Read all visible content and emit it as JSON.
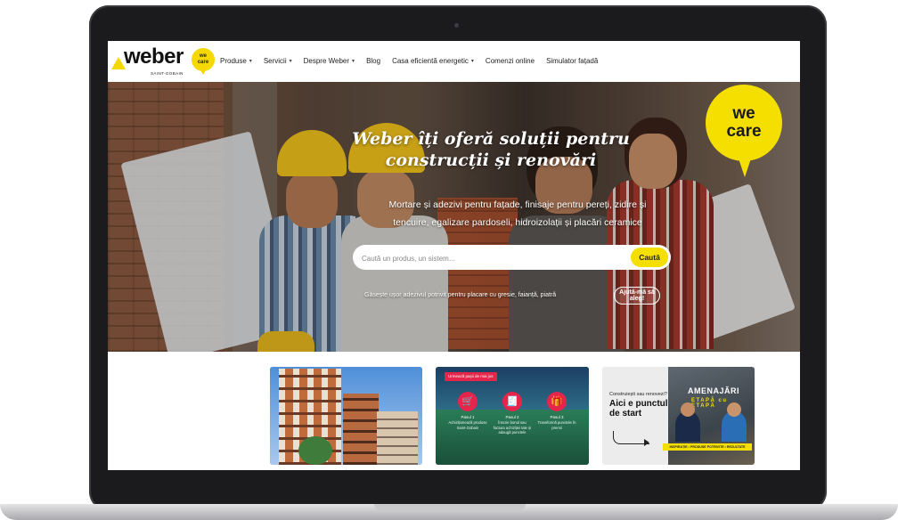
{
  "nav": {
    "logo_word": "weber",
    "logo_sub": "SAINT-GOBAIN",
    "logo_badge_top": "we",
    "logo_badge_bottom": "care",
    "menu": [
      {
        "label": "Produse",
        "dropdown": true
      },
      {
        "label": "Servicii",
        "dropdown": true
      },
      {
        "label": "Despre Weber",
        "dropdown": true
      },
      {
        "label": "Blog",
        "dropdown": false
      },
      {
        "label": "Casa eficientă energetic",
        "dropdown": true
      },
      {
        "label": "Comenzi online",
        "dropdown": false
      },
      {
        "label": "Simulator fațadă",
        "dropdown": false
      }
    ],
    "caret_glyph": "▾"
  },
  "hero": {
    "title_line1": "Weber îți oferă soluții pentru",
    "title_line2": "construcții și renovări",
    "subtitle_line1": "Mortare și adezivi pentru fațade, finisaje pentru pereți, zidire și",
    "subtitle_line2": "tencuire, egalizare pardoseli, hidroizolații și placări ceramice",
    "search_placeholder": "Caută un produs, un sistem...",
    "search_button": "Caută",
    "adhesive_text": "Găsește ușor adezivul potrivit pentru placare cu gresie, faianță, piatră",
    "help_button": "Ajută-mă să aleg!",
    "badge_line1": "we",
    "badge_line2": "care"
  },
  "cards": {
    "card2": {
      "tag": "Urmează pașii de mai jos",
      "steps": [
        {
          "title": "Pasul 1",
          "text": "Achiziționează produse Saint-Gobain",
          "icon": "🛒"
        },
        {
          "title": "Pasul 2",
          "text": "Înscrie bonul sau factura achiziției tale și adaugă punctele",
          "icon": "🧾"
        },
        {
          "title": "Pasul 3",
          "text": "Transformă punctele în premii",
          "icon": "🎁"
        }
      ]
    },
    "card3": {
      "question": "Construiești sau renovezi?",
      "headline": "Aici e punctul de start",
      "title": "AMENAJĂRI",
      "etapa": "ETAPĂ cu ETAPĂ",
      "banner": "INSPIRAȚIE • PRODUSE POTRIVITE • REZULTATE"
    }
  },
  "colors": {
    "brand_yellow": "#f5df00",
    "promo_red": "#e5254b",
    "laptop_bezel": "#1b1b1e"
  }
}
